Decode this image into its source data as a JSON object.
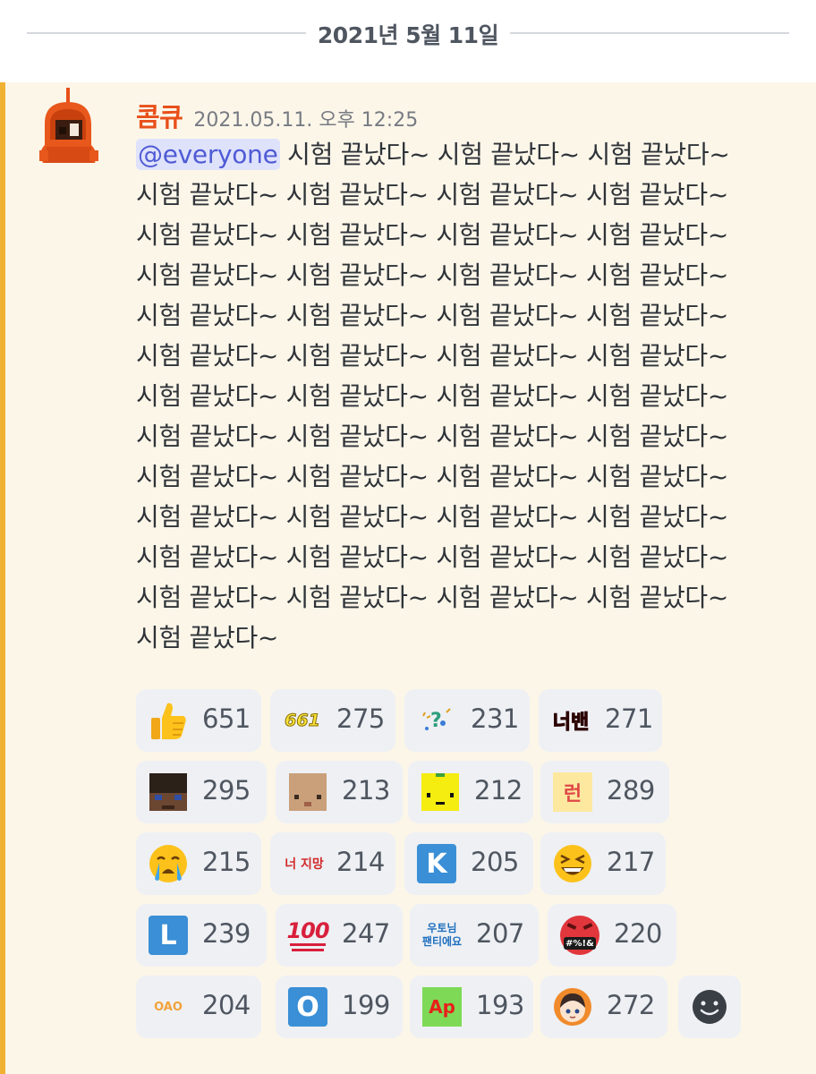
{
  "date_divider": "2021년 5월 11일",
  "message": {
    "username": "콤큐",
    "timestamp": "2021.05.11. 오후 12:25",
    "mention": "@everyone",
    "lines": [
      " 시험 끝났다~ 시험 끝났다~ 시험 끝났다~",
      "시험 끝났다~ 시험 끝났다~ 시험 끝났다~ 시험 끝났다~",
      "시험 끝났다~ 시험 끝났다~ 시험 끝났다~ 시험 끝났다~",
      "시험 끝났다~ 시험 끝났다~ 시험 끝났다~ 시험 끝났다~",
      "시험 끝났다~ 시험 끝났다~ 시험 끝났다~ 시험 끝났다~",
      "시험 끝났다~ 시험 끝났다~ 시험 끝났다~ 시험 끝났다~",
      "시험 끝났다~ 시험 끝났다~ 시험 끝났다~ 시험 끝났다~",
      "시험 끝났다~ 시험 끝났다~ 시험 끝났다~ 시험 끝났다~",
      "시험 끝났다~ 시험 끝났다~ 시험 끝났다~ 시험 끝났다~",
      "시험 끝났다~ 시험 끝났다~ 시험 끝났다~ 시험 끝났다~",
      "시험 끝났다~ 시험 끝났다~ 시험 끝났다~ 시험 끝났다~",
      "시험 끝났다~ 시험 끝났다~ 시험 끝났다~ 시험 끝났다~",
      "시험 끝났다~"
    ]
  },
  "reactions": [
    {
      "icon": "thumbs-up-icon",
      "count": "651"
    },
    {
      "icon": "661-emoji-icon",
      "emoji_text": "661",
      "count": "275"
    },
    {
      "icon": "question-sparkle-icon",
      "count": "231"
    },
    {
      "icon": "neobaen-emoji-icon",
      "emoji_text": "너밴",
      "count": "271"
    },
    {
      "icon": "minecraft-face-dark-icon",
      "count": "295"
    },
    {
      "icon": "minecraft-face-tan-icon",
      "count": "213"
    },
    {
      "icon": "yellow-face-icon",
      "count": "212"
    },
    {
      "icon": "reon-emoji-icon",
      "emoji_text": "런",
      "count": "289"
    },
    {
      "icon": "crying-face-icon",
      "count": "215"
    },
    {
      "icon": "neojimang-emoji-icon",
      "emoji_text": "너 지망",
      "count": "214"
    },
    {
      "icon": "letter-k-icon",
      "emoji_text": "K",
      "count": "205"
    },
    {
      "icon": "laughing-face-icon",
      "count": "217"
    },
    {
      "icon": "letter-l-icon",
      "emoji_text": "L",
      "count": "239"
    },
    {
      "icon": "hundred-points-icon",
      "emoji_text": "100",
      "count": "247"
    },
    {
      "icon": "utonim-fan-emoji-icon",
      "emoji_text_1": "우토님",
      "emoji_text_2": "팬티에요",
      "count": "207"
    },
    {
      "icon": "cursing-face-icon",
      "emoji_text": "#%!&",
      "count": "220"
    },
    {
      "icon": "oao-emoji-icon",
      "emoji_text": "OAO",
      "count": "204"
    },
    {
      "icon": "letter-o-icon",
      "emoji_text": "O",
      "count": "199"
    },
    {
      "icon": "ap-emoji-icon",
      "emoji_text": "Ap",
      "count": "193"
    },
    {
      "icon": "orange-hood-avatar-icon",
      "count": "272"
    },
    {
      "icon": "add-reaction-icon"
    }
  ],
  "colors": {
    "message_highlight": "#fcf6e9",
    "accent_bar": "#f0b232",
    "username": "#e8501a",
    "mention_bg": "#dfe2fb",
    "mention_text": "#4f5bd5"
  }
}
